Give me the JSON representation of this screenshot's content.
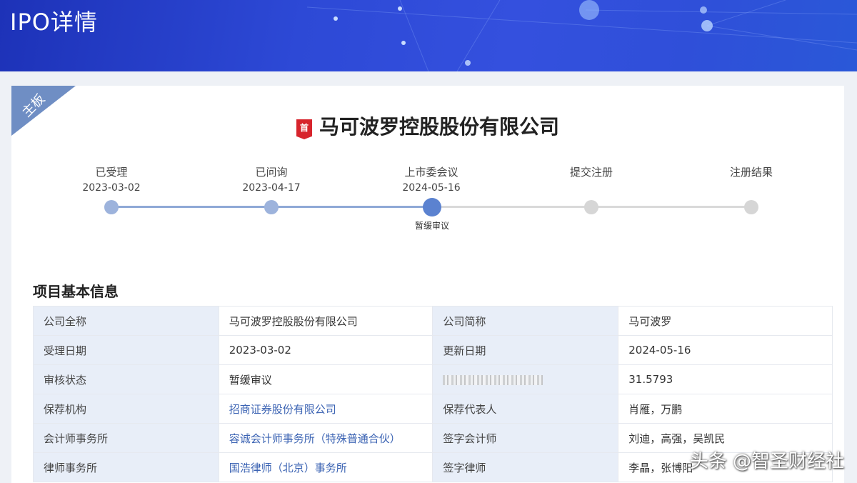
{
  "header": {
    "title": "IPO详情"
  },
  "board_tag": "主板",
  "company": {
    "badge": "首",
    "name": "马可波罗控股股份有限公司"
  },
  "timeline": {
    "steps": [
      {
        "label": "已受理",
        "date": "2023-03-02",
        "state": "done"
      },
      {
        "label": "已问询",
        "date": "2023-04-17",
        "state": "done"
      },
      {
        "label": "上市委会议",
        "date": "2024-05-16",
        "state": "current",
        "sub": "暂缓审议"
      },
      {
        "label": "提交注册",
        "date": "",
        "state": "pending"
      },
      {
        "label": "注册结果",
        "date": "",
        "state": "pending"
      }
    ]
  },
  "section": {
    "title": "项目基本信息"
  },
  "table": {
    "rows": [
      {
        "k1": "公司全称",
        "v1": "马可波罗控股股份有限公司",
        "k2": "公司简称",
        "v2": "马可波罗"
      },
      {
        "k1": "受理日期",
        "v1": "2023-03-02",
        "k2": "更新日期",
        "v2": "2024-05-16"
      },
      {
        "k1": "审核状态",
        "v1": "暂缓审议",
        "k2": "",
        "v2": "31.5793"
      },
      {
        "k1": "保荐机构",
        "v1": "招商证券股份有限公司",
        "k2": "保荐代表人",
        "v2": "肖雁，万鹏"
      },
      {
        "k1": "会计师事务所",
        "v1": "容诚会计师事务所（特殊普通合伙）",
        "k2": "签字会计师",
        "v2": "刘迪，高强，吴凯民"
      },
      {
        "k1": "律师事务所",
        "v1": "国浩律师（北京）事务所",
        "k2": "签字律师",
        "v2": "李晶，张博阳"
      }
    ]
  },
  "watermark": "头条 @智圣财经社",
  "colors": {
    "done_dot": "#9db3dc",
    "current_dot": "#5b82d0",
    "pending_dot": "#d6d6d6",
    "line_done": "#8fa9d6",
    "line_pending": "#d9d9d9",
    "link": "#3b63b3"
  }
}
